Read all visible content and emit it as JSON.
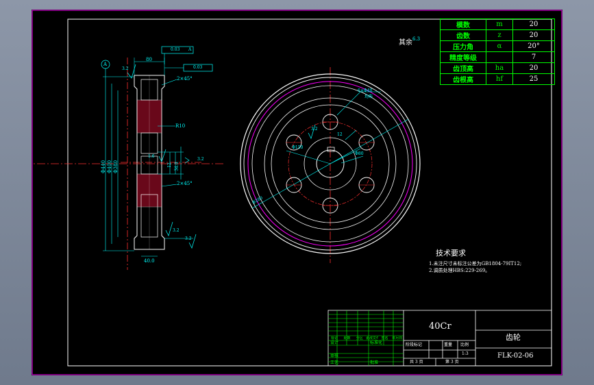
{
  "params": [
    {
      "name": "模数",
      "symbol": "m",
      "value": "20"
    },
    {
      "name": "齿数",
      "symbol": "z",
      "value": "20"
    },
    {
      "name": "压力角",
      "symbol": "α",
      "value": "20°"
    },
    {
      "name": "精度等级",
      "symbol": "",
      "value": "7"
    },
    {
      "name": "齿顶高",
      "symbol": "ha",
      "value": "20"
    },
    {
      "name": "齿根高",
      "symbol": "hf",
      "value": "25"
    }
  ],
  "roughness": {
    "other_label": "其余",
    "other_value": "6.3"
  },
  "side_view": {
    "datum": "A",
    "tol_1": "0.03",
    "tol_2": "0.03",
    "tol_datum": "A",
    "dim_width_top": "80",
    "chamfer_1": "2×45°",
    "chamfer_2": "2×45°",
    "radius": "R10",
    "dia_outer": "Φ440",
    "dia_2": "Φ400",
    "dia_3": "Φ380",
    "key_1": "12",
    "key_2": "34.4",
    "keyway_ra": "3.2",
    "rough_a": "3.2",
    "rough_b": "1.6",
    "rough_c": "3.2",
    "rough_d": "3.2",
    "hub_width": "40.0"
  },
  "front_view": {
    "holes": "6×Φ40",
    "holes_note": "均布",
    "dim_a": "Φ150",
    "dim_b": "Φ80",
    "dim_c": "Φ280",
    "dim_key": "12",
    "rough_hole": "3.2"
  },
  "tech": {
    "title": "技术要求",
    "line1": "1.未注尺寸未标注公差为GB1804-79IT12;",
    "line2": "2.调质处理HBS:229-269。"
  },
  "title_block": {
    "material": "40Cr",
    "part_name": "齿轮",
    "drawing_no": "FLK-02-06",
    "scale": "1:3",
    "sheets": "共 3 页",
    "sheet_no": "第 3 页",
    "stage": "阶段标记",
    "weight": "重量",
    "ratio": "比例",
    "row_labels": [
      "标记",
      "处数",
      "分区",
      "更改文件号",
      "签名",
      "年月日"
    ],
    "design": "设计",
    "std": "标准化",
    "check": "审核",
    "craft": "工艺",
    "approve": "批准"
  }
}
